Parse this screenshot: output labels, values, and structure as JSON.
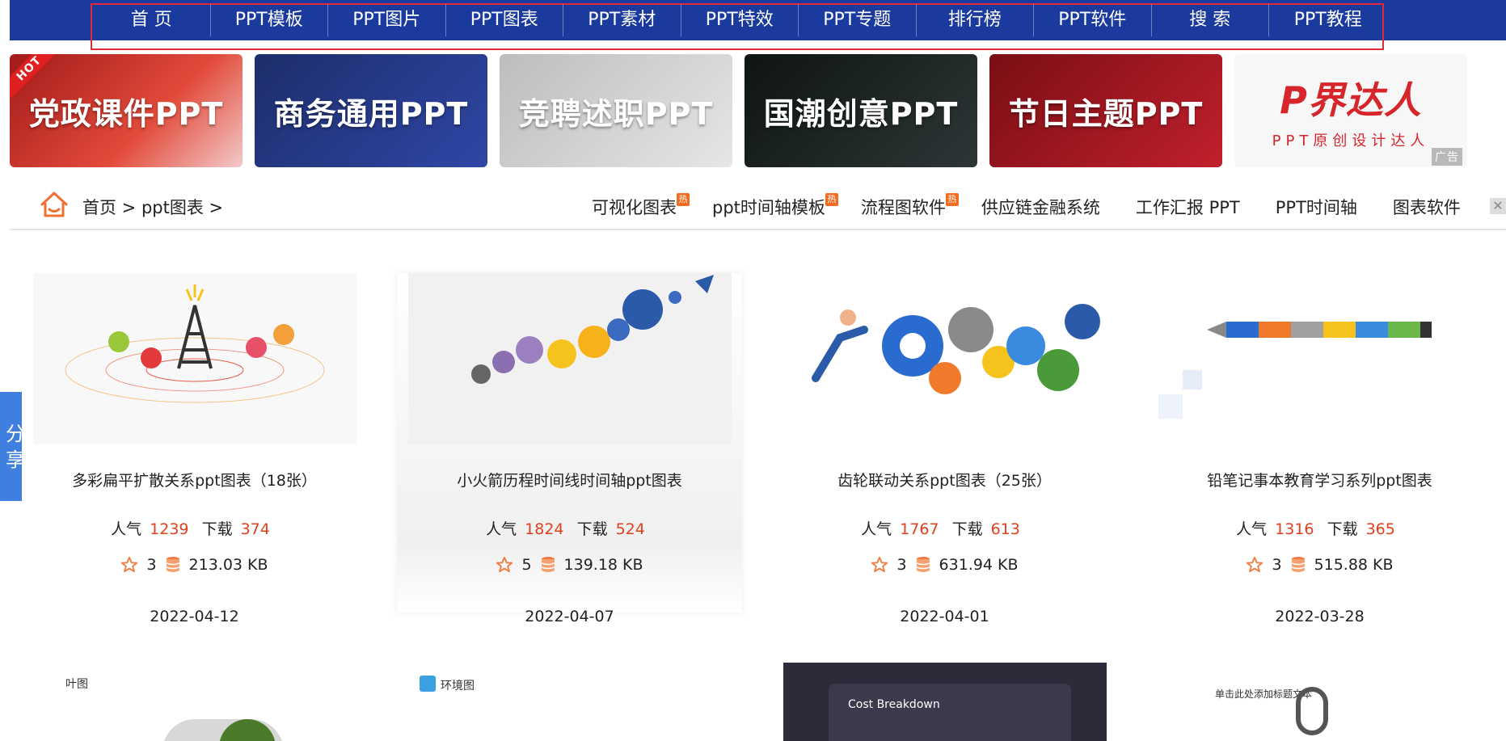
{
  "nav": {
    "items": [
      "首 页",
      "PPT模板",
      "PPT图片",
      "PPT图表",
      "PPT素材",
      "PPT特效",
      "PPT专题",
      "排行榜",
      "PPT软件",
      "搜 索",
      "PPT教程"
    ]
  },
  "banners": [
    {
      "text": "党政课件PPT",
      "hot": "HOT"
    },
    {
      "text": "商务通用PPT"
    },
    {
      "text": "竞聘述职PPT"
    },
    {
      "text": "国潮创意PPT"
    },
    {
      "text": "节日主题PPT"
    },
    {
      "logo": "P界达人",
      "sub": "PPT原创设计达人",
      "ad": "广告"
    }
  ],
  "breadcrumb": {
    "text": "首页 > ppt图表 >"
  },
  "tags": [
    {
      "label": "可视化图表",
      "hot": "热"
    },
    {
      "label": "ppt时间轴模板",
      "hot": "热"
    },
    {
      "label": "流程图软件",
      "hot": "热"
    },
    {
      "label": "供应链金融系统"
    },
    {
      "label": "工作汇报 PPT"
    },
    {
      "label": "PPT时间轴"
    },
    {
      "label": "图表软件"
    }
  ],
  "close": "✕",
  "share": {
    "line1": "分",
    "line2": "享"
  },
  "labels": {
    "popularity": "人气",
    "downloads": "下载"
  },
  "cards": [
    {
      "title": "多彩扁平扩散关系ppt图表（18张）",
      "popularity": "1239",
      "downloads": "374",
      "stars": "3",
      "size": "213.03 KB",
      "date": "2022-04-12"
    },
    {
      "title": "小火箭历程时间线时间轴ppt图表",
      "popularity": "1824",
      "downloads": "524",
      "stars": "5",
      "size": "139.18 KB",
      "date": "2022-04-07"
    },
    {
      "title": "齿轮联动关系ppt图表（25张）",
      "popularity": "1767",
      "downloads": "613",
      "stars": "3",
      "size": "631.94 KB",
      "date": "2022-04-01"
    },
    {
      "title": "铅笔记事本教育学习系列ppt图表",
      "popularity": "1316",
      "downloads": "365",
      "stars": "3",
      "size": "515.88 KB",
      "date": "2022-03-28"
    }
  ],
  "row2": [
    {
      "label": "叶图"
    },
    {
      "label": "环境图"
    },
    {
      "label": "Cost Breakdown"
    },
    {
      "label": "单击此处添加标题文本"
    }
  ]
}
